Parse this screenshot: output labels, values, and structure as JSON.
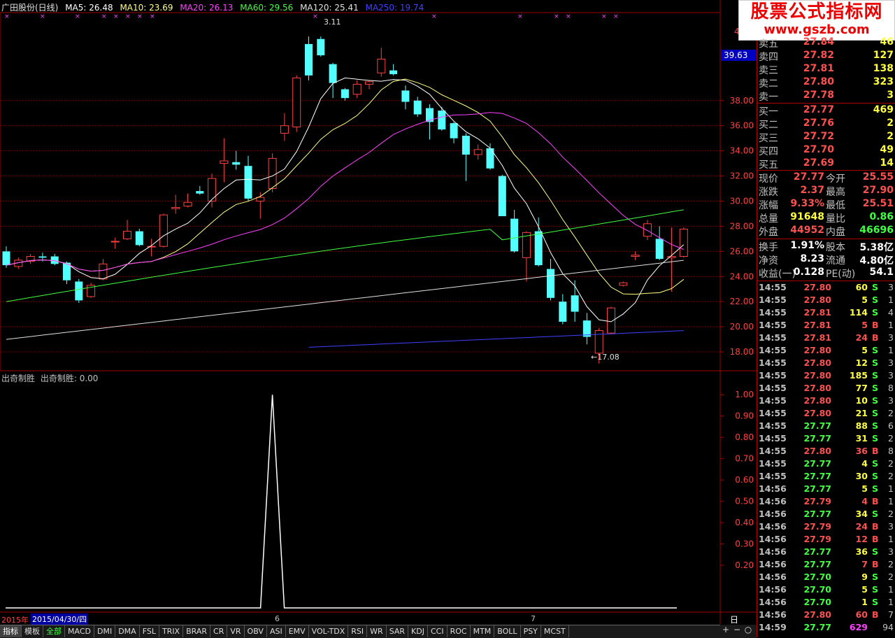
{
  "header": {
    "title": "广田股份(日线)",
    "ma5": "MA5: 26.48",
    "ma10": "MA10: 23.69",
    "ma20": "MA20: 26.13",
    "ma60": "MA60: 29.56",
    "ma120": "MA120: 25.41",
    "ma250": "MA250: 19.74"
  },
  "colors": {
    "up": "#ff4040",
    "down": "#54ffff",
    "ma5": "#ffffff",
    "ma10": "#ffff80",
    "ma20": "#ff40ff",
    "ma60": "#40ff40",
    "ma120": "#e0e0e0",
    "ma250": "#4040ff",
    "grid": "#a00000"
  },
  "main_labels": {
    "high_mark": "3.11",
    "low_mark": "17.08",
    "current_tag": "39.63",
    "top_axis_partial": "4"
  },
  "sub_header": {
    "name": "出奇制胜",
    "value": "出奇制胜: 0.00"
  },
  "x_axis": {
    "year": "2015年",
    "selected_date": "2015/04/30/四",
    "month6": "6",
    "month7": "7",
    "period": "日线"
  },
  "chart_data": [
    {
      "type": "candlestick",
      "title": "广田股份(日线)",
      "ylim": [
        16.5,
        45
      ],
      "yticks": [
        "18.00",
        "20.00",
        "22.00",
        "24.00",
        "26.00",
        "28.00",
        "30.00",
        "32.00",
        "34.00",
        "36.00",
        "38.00"
      ],
      "candles": [
        {
          "o": 26.0,
          "h": 26.4,
          "l": 24.7,
          "c": 24.9
        },
        {
          "o": 24.8,
          "h": 25.5,
          "l": 24.6,
          "c": 25.3
        },
        {
          "o": 25.2,
          "h": 25.8,
          "l": 25.0,
          "c": 25.6
        },
        {
          "o": 25.6,
          "h": 25.9,
          "l": 25.2,
          "c": 25.5
        },
        {
          "o": 25.6,
          "h": 25.8,
          "l": 24.9,
          "c": 25.0
        },
        {
          "o": 25.1,
          "h": 25.2,
          "l": 23.4,
          "c": 23.7
        },
        {
          "o": 23.6,
          "h": 23.8,
          "l": 21.9,
          "c": 22.1
        },
        {
          "o": 22.4,
          "h": 23.5,
          "l": 22.3,
          "c": 23.3
        },
        {
          "o": 23.8,
          "h": 25.4,
          "l": 23.7,
          "c": 25.0
        },
        {
          "o": 26.8,
          "h": 27.1,
          "l": 26.2,
          "c": 26.8
        },
        {
          "o": 27.0,
          "h": 28.5,
          "l": 26.9,
          "c": 27.6
        },
        {
          "o": 27.6,
          "h": 27.8,
          "l": 26.4,
          "c": 26.5
        },
        {
          "o": 26.4,
          "h": 27.0,
          "l": 25.6,
          "c": 26.4
        },
        {
          "o": 26.4,
          "h": 29.0,
          "l": 26.3,
          "c": 28.9
        },
        {
          "o": 29.4,
          "h": 30.5,
          "l": 29.0,
          "c": 29.5
        },
        {
          "o": 29.6,
          "h": 30.6,
          "l": 29.5,
          "c": 29.9
        },
        {
          "o": 30.8,
          "h": 31.2,
          "l": 30.5,
          "c": 30.6
        },
        {
          "o": 30.0,
          "h": 32.2,
          "l": 29.5,
          "c": 31.8
        },
        {
          "o": 33.0,
          "h": 35.0,
          "l": 31.5,
          "c": 33.2
        },
        {
          "o": 33.1,
          "h": 34.0,
          "l": 32.5,
          "c": 32.9
        },
        {
          "o": 32.8,
          "h": 33.6,
          "l": 30.0,
          "c": 30.2
        },
        {
          "o": 30.0,
          "h": 30.7,
          "l": 28.6,
          "c": 30.3
        },
        {
          "o": 31.0,
          "h": 33.8,
          "l": 30.7,
          "c": 33.4
        },
        {
          "o": 35.4,
          "h": 37.0,
          "l": 34.8,
          "c": 36.0
        },
        {
          "o": 35.9,
          "h": 40.0,
          "l": 35.5,
          "c": 39.8
        },
        {
          "o": 42.5,
          "h": 43.1,
          "l": 39.6,
          "c": 40.0
        },
        {
          "o": 42.9,
          "h": 43.1,
          "l": 41.5,
          "c": 41.6
        },
        {
          "o": 40.9,
          "h": 41.0,
          "l": 38.2,
          "c": 39.4
        },
        {
          "o": 38.9,
          "h": 39.0,
          "l": 38.0,
          "c": 38.2
        },
        {
          "o": 38.5,
          "h": 39.6,
          "l": 38.2,
          "c": 39.3
        },
        {
          "o": 39.3,
          "h": 39.6,
          "l": 38.9,
          "c": 39.5
        },
        {
          "o": 40.2,
          "h": 42.2,
          "l": 39.9,
          "c": 41.3
        },
        {
          "o": 40.4,
          "h": 40.9,
          "l": 40.0,
          "c": 40.1
        },
        {
          "o": 38.8,
          "h": 39.2,
          "l": 37.3,
          "c": 37.9
        },
        {
          "o": 38.0,
          "h": 38.3,
          "l": 36.7,
          "c": 36.9
        },
        {
          "o": 37.4,
          "h": 37.7,
          "l": 34.9,
          "c": 36.3
        },
        {
          "o": 37.2,
          "h": 37.5,
          "l": 35.6,
          "c": 35.7
        },
        {
          "o": 36.2,
          "h": 36.3,
          "l": 34.6,
          "c": 35.0
        },
        {
          "o": 35.2,
          "h": 35.4,
          "l": 31.6,
          "c": 33.7
        },
        {
          "o": 33.7,
          "h": 34.5,
          "l": 33.3,
          "c": 34.1
        },
        {
          "o": 34.2,
          "h": 34.6,
          "l": 32.5,
          "c": 32.6
        },
        {
          "o": 32.0,
          "h": 32.1,
          "l": 28.8,
          "c": 28.8
        },
        {
          "o": 28.6,
          "h": 29.3,
          "l": 25.9,
          "c": 26.0
        },
        {
          "o": 25.5,
          "h": 27.6,
          "l": 23.6,
          "c": 27.5
        },
        {
          "o": 27.6,
          "h": 28.7,
          "l": 24.8,
          "c": 24.9
        },
        {
          "o": 24.6,
          "h": 25.4,
          "l": 22.1,
          "c": 22.3
        },
        {
          "o": 22.0,
          "h": 22.6,
          "l": 20.2,
          "c": 20.4
        },
        {
          "o": 22.5,
          "h": 23.7,
          "l": 20.4,
          "c": 21.2
        },
        {
          "o": 20.5,
          "h": 21.1,
          "l": 18.6,
          "c": 19.2
        },
        {
          "o": 17.9,
          "h": 19.9,
          "l": 17.08,
          "c": 19.7
        },
        {
          "o": 19.5,
          "h": 21.6,
          "l": 19.4,
          "c": 21.5
        },
        {
          "o": 23.3,
          "h": 23.6,
          "l": 23.2,
          "c": 23.5
        },
        {
          "o": 25.6,
          "h": 26.0,
          "l": 25.3,
          "c": 25.7
        },
        {
          "o": 27.2,
          "h": 28.5,
          "l": 26.9,
          "c": 28.2
        },
        {
          "o": 27.0,
          "h": 28.0,
          "l": 25.3,
          "c": 25.4
        },
        {
          "o": 25.5,
          "h": 27.9,
          "l": 22.8,
          "c": 25.6
        },
        {
          "o": 25.6,
          "h": 27.9,
          "l": 25.5,
          "c": 27.77
        }
      ]
    },
    {
      "type": "line",
      "name": "出奇制胜",
      "ylim": [
        0,
        1.05
      ],
      "yticks": [
        "0.20",
        "0.30",
        "0.40",
        "0.50",
        "0.60",
        "0.70",
        "0.80",
        "0.90",
        "1.00"
      ],
      "values_note": "zero everywhere except a single spike to 1.00",
      "spike_index": 22,
      "spike_value": 1.0
    }
  ],
  "order_book": {
    "sell": [
      {
        "label": "卖五",
        "price": "27.84",
        "vol": "46"
      },
      {
        "label": "卖四",
        "price": "27.82",
        "vol": "127"
      },
      {
        "label": "卖三",
        "price": "27.81",
        "vol": "138"
      },
      {
        "label": "卖二",
        "price": "27.80",
        "vol": "323"
      },
      {
        "label": "卖一",
        "price": "27.78",
        "vol": "3"
      }
    ],
    "buy": [
      {
        "label": "买一",
        "price": "27.77",
        "vol": "469"
      },
      {
        "label": "买二",
        "price": "27.76",
        "vol": "2"
      },
      {
        "label": "买三",
        "price": "27.72",
        "vol": "2"
      },
      {
        "label": "买四",
        "price": "27.70",
        "vol": "49"
      },
      {
        "label": "买五",
        "price": "27.69",
        "vol": "14"
      }
    ]
  },
  "info": [
    {
      "l1": "现价",
      "v1": "27.77",
      "c1": "#ff5050",
      "l2": "今开",
      "v2": "25.55",
      "c2": "#ff5050"
    },
    {
      "l1": "涨跌",
      "v1": "2.37",
      "c1": "#ff5050",
      "l2": "最高",
      "v2": "27.90",
      "c2": "#ff5050"
    },
    {
      "l1": "涨幅",
      "v1": "9.33%",
      "c1": "#ff5050",
      "l2": "最低",
      "v2": "25.51",
      "c2": "#ff5050"
    },
    {
      "l1": "总量",
      "v1": "91648",
      "c1": "#ffff40",
      "l2": "量比",
      "v2": "0.86",
      "c2": "#40ff40"
    },
    {
      "l1": "外盘",
      "v1": "44952",
      "c1": "#ff5050",
      "l2": "内盘",
      "v2": "46696",
      "c2": "#40ff40"
    }
  ],
  "info2": [
    {
      "l1": "换手",
      "v1": "1.91%",
      "c1": "#ffffff",
      "l2": "股本",
      "v2": "5.38亿",
      "c2": "#ffffff"
    },
    {
      "l1": "净资",
      "v1": "8.23",
      "c1": "#ffffff",
      "l2": "流通",
      "v2": "4.80亿",
      "c2": "#ffffff"
    },
    {
      "l1": "收益(一)",
      "v1": "0.128",
      "c1": "#ffffff",
      "l2": "PE(动)",
      "v2": "54.1",
      "c2": "#ffffff"
    }
  ],
  "ticks": [
    {
      "t": "14:55",
      "p": "27.80",
      "v": "60",
      "d": "S",
      "n": "3"
    },
    {
      "t": "14:55",
      "p": "27.80",
      "v": "5",
      "d": "S",
      "n": "1"
    },
    {
      "t": "14:55",
      "p": "27.81",
      "v": "114",
      "d": "S",
      "n": "4"
    },
    {
      "t": "14:55",
      "p": "27.81",
      "v": "5",
      "d": "B",
      "n": "1"
    },
    {
      "t": "14:55",
      "p": "27.81",
      "v": "24",
      "d": "B",
      "n": "3"
    },
    {
      "t": "14:55",
      "p": "27.80",
      "v": "5",
      "d": "S",
      "n": "1"
    },
    {
      "t": "14:55",
      "p": "27.80",
      "v": "12",
      "d": "S",
      "n": "3"
    },
    {
      "t": "14:55",
      "p": "27.80",
      "v": "185",
      "d": "S",
      "n": "3"
    },
    {
      "t": "14:55",
      "p": "27.80",
      "v": "77",
      "d": "S",
      "n": "8"
    },
    {
      "t": "14:55",
      "p": "27.80",
      "v": "10",
      "d": "S",
      "n": "3"
    },
    {
      "t": "14:55",
      "p": "27.80",
      "v": "21",
      "d": "S",
      "n": "2"
    },
    {
      "t": "14:55",
      "p": "27.77",
      "v": "88",
      "d": "S",
      "n": "6"
    },
    {
      "t": "14:55",
      "p": "27.77",
      "v": "31",
      "d": "S",
      "n": "2"
    },
    {
      "t": "14:55",
      "p": "27.80",
      "v": "36",
      "d": "B",
      "n": "8"
    },
    {
      "t": "14:55",
      "p": "27.77",
      "v": "4",
      "d": "S",
      "n": "2"
    },
    {
      "t": "14:55",
      "p": "27.77",
      "v": "30",
      "d": "S",
      "n": "2"
    },
    {
      "t": "14:56",
      "p": "27.77",
      "v": "5",
      "d": "S",
      "n": "1"
    },
    {
      "t": "14:56",
      "p": "27.79",
      "v": "4",
      "d": "B",
      "n": "1"
    },
    {
      "t": "14:56",
      "p": "27.77",
      "v": "34",
      "d": "S",
      "n": "2"
    },
    {
      "t": "14:56",
      "p": "27.79",
      "v": "24",
      "d": "B",
      "n": "3"
    },
    {
      "t": "14:56",
      "p": "27.79",
      "v": "12",
      "d": "B",
      "n": "1"
    },
    {
      "t": "14:56",
      "p": "27.77",
      "v": "36",
      "d": "S",
      "n": "3"
    },
    {
      "t": "14:56",
      "p": "27.77",
      "v": "7",
      "d": "B",
      "n": "2"
    },
    {
      "t": "14:56",
      "p": "27.70",
      "v": "9",
      "d": "S",
      "n": "2"
    },
    {
      "t": "14:56",
      "p": "27.70",
      "v": "5",
      "d": "S",
      "n": "1"
    },
    {
      "t": "14:56",
      "p": "27.70",
      "v": "1",
      "d": "S",
      "n": "1"
    },
    {
      "t": "14:56",
      "p": "27.80",
      "v": "60",
      "d": "B",
      "n": "7"
    },
    {
      "t": "14:59",
      "p": "27.77",
      "v": "629",
      "d": "",
      "n": "94"
    }
  ],
  "watermark": {
    "line1": "股票公式指标网",
    "line2": "www.gszb.com"
  },
  "tabs": [
    "指标",
    "模板",
    "全部",
    "MACD",
    "DMI",
    "DMA",
    "FSL",
    "TRIX",
    "BRAR",
    "CR",
    "VR",
    "OBV",
    "ASI",
    "EMV",
    "VOL-TDX",
    "RSI",
    "WR",
    "SAR",
    "KDJ",
    "CCI",
    "ROC",
    "MTM",
    "BOLL",
    "PSY",
    "MCST"
  ],
  "corner_buttons": [
    "+",
    "−",
    "○"
  ]
}
